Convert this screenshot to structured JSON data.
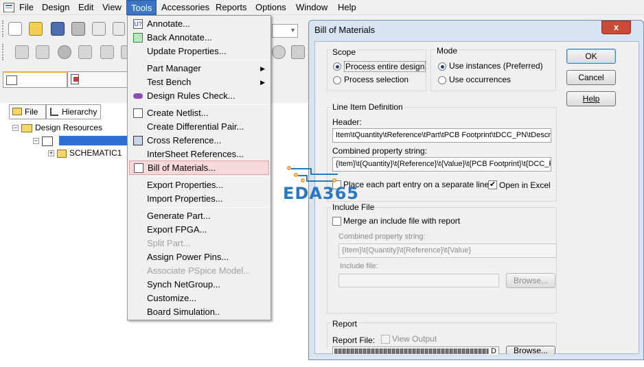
{
  "menubar": {
    "items": [
      "File",
      "Design",
      "Edit",
      "View",
      "Tools",
      "Accessories",
      "Reports",
      "Options",
      "Window",
      "Help"
    ],
    "active": "Tools"
  },
  "left_panel": {
    "tab_file": "File",
    "tab_hierarchy": "Hierarchy",
    "tree": {
      "root": "Design Resources",
      "schematic": "SCHEMATIC1"
    }
  },
  "tools_menu": {
    "items": [
      {
        "label": "Annotate...",
        "icon": "annotate-icon"
      },
      {
        "label": "Back Annotate...",
        "icon": "back-annotate-icon"
      },
      {
        "label": "Update Properties...",
        "icon": ""
      },
      {
        "label": "Part Manager",
        "icon": "",
        "submenu": true
      },
      {
        "label": "Test Bench",
        "icon": "",
        "submenu": true
      },
      {
        "label": "Design Rules Check...",
        "icon": "drc-icon"
      },
      {
        "label": "Create Netlist...",
        "icon": "netlist-icon"
      },
      {
        "label": "Create Differential Pair...",
        "icon": ""
      },
      {
        "label": "Cross Reference...",
        "icon": "cross-reference-icon"
      },
      {
        "label": "InterSheet References...",
        "icon": ""
      },
      {
        "label": "Bill of Materials...",
        "icon": "bom-icon",
        "highlighted": true
      },
      {
        "label": "Export Properties...",
        "icon": ""
      },
      {
        "label": "Import Properties...",
        "icon": ""
      },
      {
        "label": "Generate Part...",
        "icon": ""
      },
      {
        "label": "Export FPGA...",
        "icon": ""
      },
      {
        "label": "Split Part...",
        "icon": "",
        "disabled": true
      },
      {
        "label": "Assign Power Pins...",
        "icon": ""
      },
      {
        "label": "Associate PSpice Model...",
        "icon": "",
        "disabled": true
      },
      {
        "label": "Synch NetGroup...",
        "icon": ""
      },
      {
        "label": "Customize...",
        "icon": ""
      },
      {
        "label": "Board Simulation..",
        "icon": ""
      }
    ]
  },
  "dialog": {
    "title": "Bill of Materials",
    "close": "x",
    "scope": {
      "label": "Scope",
      "opt1": "Process entire design",
      "opt2": "Process selection",
      "selected": "Process entire design"
    },
    "mode": {
      "label": "Mode",
      "opt1": "Use instances (Preferred)",
      "opt2": "Use occurrences",
      "selected": "Use instances (Preferred)"
    },
    "line_item": {
      "label": "Line Item Definition",
      "header_label": "Header:",
      "header_value": "Item\\tQuantity\\tReference\\tPart\\tPCB Footprint\\tDCC_PN\\tDescrip",
      "combined_label": "Combined property string:",
      "combined_value": "{Item}\\t{Quantity}\\t{Reference}\\t{Value}\\t{PCB Footprint}\\t{DCC_P",
      "place_each": "Place each part entry on a separate line",
      "place_each_checked": false,
      "open_excel": "Open in Excel",
      "open_excel_checked": true
    },
    "include": {
      "label": "Include File",
      "merge": "Merge an include file with report",
      "merge_checked": false,
      "combined_label": "Combined property string:",
      "combined_value": "{Item}\\t{Quantity}\\t{Reference}\\t{Value}",
      "include_label": "Include file:",
      "include_value": "",
      "browse": "Browse..."
    },
    "report": {
      "label": "Report",
      "file_label": "Report File:",
      "view_output": "View Output",
      "view_output_checked": false,
      "file_suffix": "D",
      "browse": "Browse..."
    },
    "buttons": {
      "ok": "OK",
      "cancel": "Cancel",
      "help": "Help"
    }
  },
  "watermark": {
    "text": "EDA365"
  },
  "colors": {
    "menu_active": "#3b75c4",
    "menu_highlight": "#f7d9dc",
    "watermark_blue": "#2a78c2",
    "watermark_orange": "#e9a02f"
  }
}
